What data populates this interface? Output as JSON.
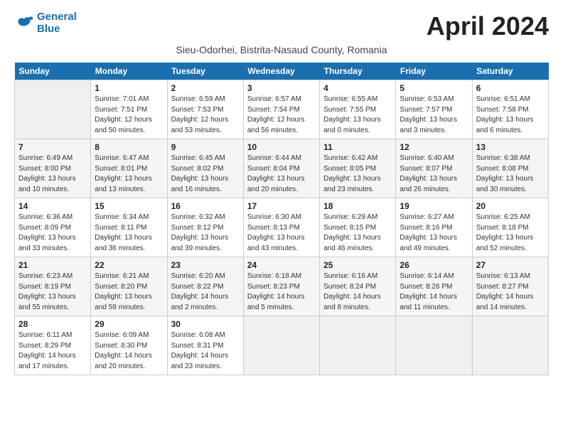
{
  "logo": {
    "line1": "General",
    "line2": "Blue"
  },
  "title": "April 2024",
  "subtitle": "Sieu-Odorhei, Bistrita-Nasaud County, Romania",
  "days_of_week": [
    "Sunday",
    "Monday",
    "Tuesday",
    "Wednesday",
    "Thursday",
    "Friday",
    "Saturday"
  ],
  "weeks": [
    [
      {
        "day": "",
        "sunrise": "",
        "sunset": "",
        "daylight": ""
      },
      {
        "day": "1",
        "sunrise": "Sunrise: 7:01 AM",
        "sunset": "Sunset: 7:51 PM",
        "daylight": "Daylight: 12 hours and 50 minutes."
      },
      {
        "day": "2",
        "sunrise": "Sunrise: 6:59 AM",
        "sunset": "Sunset: 7:53 PM",
        "daylight": "Daylight: 12 hours and 53 minutes."
      },
      {
        "day": "3",
        "sunrise": "Sunrise: 6:57 AM",
        "sunset": "Sunset: 7:54 PM",
        "daylight": "Daylight: 12 hours and 56 minutes."
      },
      {
        "day": "4",
        "sunrise": "Sunrise: 6:55 AM",
        "sunset": "Sunset: 7:55 PM",
        "daylight": "Daylight: 13 hours and 0 minutes."
      },
      {
        "day": "5",
        "sunrise": "Sunrise: 6:53 AM",
        "sunset": "Sunset: 7:57 PM",
        "daylight": "Daylight: 13 hours and 3 minutes."
      },
      {
        "day": "6",
        "sunrise": "Sunrise: 6:51 AM",
        "sunset": "Sunset: 7:58 PM",
        "daylight": "Daylight: 13 hours and 6 minutes."
      }
    ],
    [
      {
        "day": "7",
        "sunrise": "Sunrise: 6:49 AM",
        "sunset": "Sunset: 8:00 PM",
        "daylight": "Daylight: 13 hours and 10 minutes."
      },
      {
        "day": "8",
        "sunrise": "Sunrise: 6:47 AM",
        "sunset": "Sunset: 8:01 PM",
        "daylight": "Daylight: 13 hours and 13 minutes."
      },
      {
        "day": "9",
        "sunrise": "Sunrise: 6:45 AM",
        "sunset": "Sunset: 8:02 PM",
        "daylight": "Daylight: 13 hours and 16 minutes."
      },
      {
        "day": "10",
        "sunrise": "Sunrise: 6:44 AM",
        "sunset": "Sunset: 8:04 PM",
        "daylight": "Daylight: 13 hours and 20 minutes."
      },
      {
        "day": "11",
        "sunrise": "Sunrise: 6:42 AM",
        "sunset": "Sunset: 8:05 PM",
        "daylight": "Daylight: 13 hours and 23 minutes."
      },
      {
        "day": "12",
        "sunrise": "Sunrise: 6:40 AM",
        "sunset": "Sunset: 8:07 PM",
        "daylight": "Daylight: 13 hours and 26 minutes."
      },
      {
        "day": "13",
        "sunrise": "Sunrise: 6:38 AM",
        "sunset": "Sunset: 8:08 PM",
        "daylight": "Daylight: 13 hours and 30 minutes."
      }
    ],
    [
      {
        "day": "14",
        "sunrise": "Sunrise: 6:36 AM",
        "sunset": "Sunset: 8:09 PM",
        "daylight": "Daylight: 13 hours and 33 minutes."
      },
      {
        "day": "15",
        "sunrise": "Sunrise: 6:34 AM",
        "sunset": "Sunset: 8:11 PM",
        "daylight": "Daylight: 13 hours and 36 minutes."
      },
      {
        "day": "16",
        "sunrise": "Sunrise: 6:32 AM",
        "sunset": "Sunset: 8:12 PM",
        "daylight": "Daylight: 13 hours and 39 minutes."
      },
      {
        "day": "17",
        "sunrise": "Sunrise: 6:30 AM",
        "sunset": "Sunset: 8:13 PM",
        "daylight": "Daylight: 13 hours and 43 minutes."
      },
      {
        "day": "18",
        "sunrise": "Sunrise: 6:29 AM",
        "sunset": "Sunset: 8:15 PM",
        "daylight": "Daylight: 13 hours and 46 minutes."
      },
      {
        "day": "19",
        "sunrise": "Sunrise: 6:27 AM",
        "sunset": "Sunset: 8:16 PM",
        "daylight": "Daylight: 13 hours and 49 minutes."
      },
      {
        "day": "20",
        "sunrise": "Sunrise: 6:25 AM",
        "sunset": "Sunset: 8:18 PM",
        "daylight": "Daylight: 13 hours and 52 minutes."
      }
    ],
    [
      {
        "day": "21",
        "sunrise": "Sunrise: 6:23 AM",
        "sunset": "Sunset: 8:19 PM",
        "daylight": "Daylight: 13 hours and 55 minutes."
      },
      {
        "day": "22",
        "sunrise": "Sunrise: 6:21 AM",
        "sunset": "Sunset: 8:20 PM",
        "daylight": "Daylight: 13 hours and 59 minutes."
      },
      {
        "day": "23",
        "sunrise": "Sunrise: 6:20 AM",
        "sunset": "Sunset: 8:22 PM",
        "daylight": "Daylight: 14 hours and 2 minutes."
      },
      {
        "day": "24",
        "sunrise": "Sunrise: 6:18 AM",
        "sunset": "Sunset: 8:23 PM",
        "daylight": "Daylight: 14 hours and 5 minutes."
      },
      {
        "day": "25",
        "sunrise": "Sunrise: 6:16 AM",
        "sunset": "Sunset: 8:24 PM",
        "daylight": "Daylight: 14 hours and 8 minutes."
      },
      {
        "day": "26",
        "sunrise": "Sunrise: 6:14 AM",
        "sunset": "Sunset: 8:26 PM",
        "daylight": "Daylight: 14 hours and 11 minutes."
      },
      {
        "day": "27",
        "sunrise": "Sunrise: 6:13 AM",
        "sunset": "Sunset: 8:27 PM",
        "daylight": "Daylight: 14 hours and 14 minutes."
      }
    ],
    [
      {
        "day": "28",
        "sunrise": "Sunrise: 6:11 AM",
        "sunset": "Sunset: 8:29 PM",
        "daylight": "Daylight: 14 hours and 17 minutes."
      },
      {
        "day": "29",
        "sunrise": "Sunrise: 6:09 AM",
        "sunset": "Sunset: 8:30 PM",
        "daylight": "Daylight: 14 hours and 20 minutes."
      },
      {
        "day": "30",
        "sunrise": "Sunrise: 6:08 AM",
        "sunset": "Sunset: 8:31 PM",
        "daylight": "Daylight: 14 hours and 23 minutes."
      },
      {
        "day": "",
        "sunrise": "",
        "sunset": "",
        "daylight": ""
      },
      {
        "day": "",
        "sunrise": "",
        "sunset": "",
        "daylight": ""
      },
      {
        "day": "",
        "sunrise": "",
        "sunset": "",
        "daylight": ""
      },
      {
        "day": "",
        "sunrise": "",
        "sunset": "",
        "daylight": ""
      }
    ]
  ]
}
